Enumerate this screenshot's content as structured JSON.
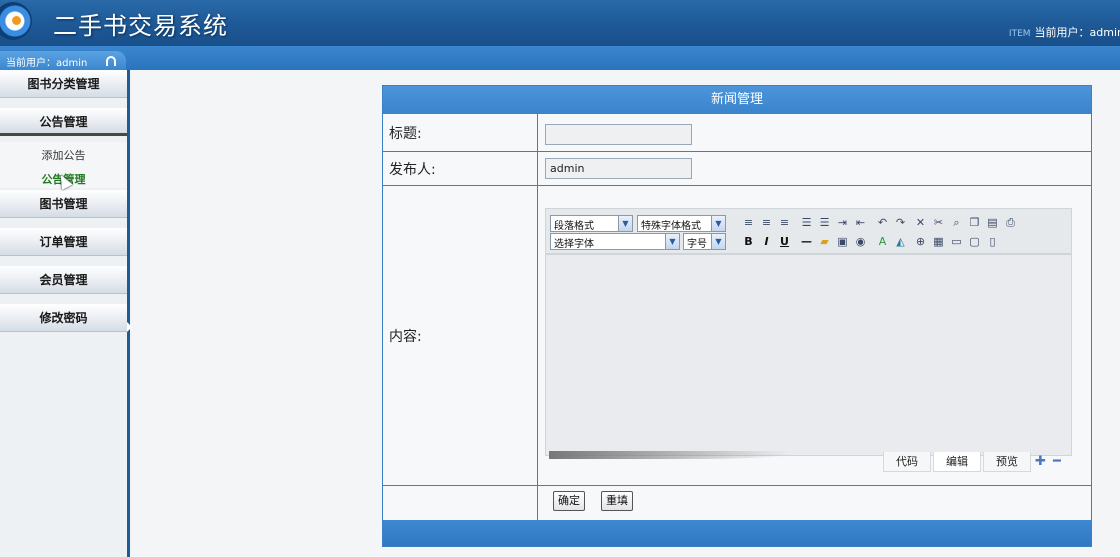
{
  "header": {
    "app_title": "二手书交易系统",
    "user_tag": "ITEM",
    "user_label": "当前用户：admin"
  },
  "subbar": {
    "user_label": "当前用户：admin"
  },
  "sidebar": {
    "items": [
      {
        "label": "图书分类管理"
      },
      {
        "label": "公告管理",
        "children": [
          {
            "label": "添加公告"
          },
          {
            "label": "公告管理"
          }
        ]
      },
      {
        "label": "图书管理"
      },
      {
        "label": "订单管理"
      },
      {
        "label": "会员管理"
      },
      {
        "label": "修改密码"
      }
    ]
  },
  "panel": {
    "title": "新闻管理",
    "fields": {
      "title_label": "标题:",
      "title_value": "",
      "publisher_label": "发布人:",
      "publisher_value": "admin",
      "content_label": "内容:"
    },
    "editor": {
      "paragraph_format": "段落格式",
      "special_font": "特殊字体格式",
      "font_select": "选择字体",
      "font_size": "字号",
      "modes": [
        "代码",
        "编辑",
        "预览"
      ],
      "active_mode": "编辑"
    },
    "buttons": {
      "submit": "确定",
      "reset": "重填"
    }
  }
}
